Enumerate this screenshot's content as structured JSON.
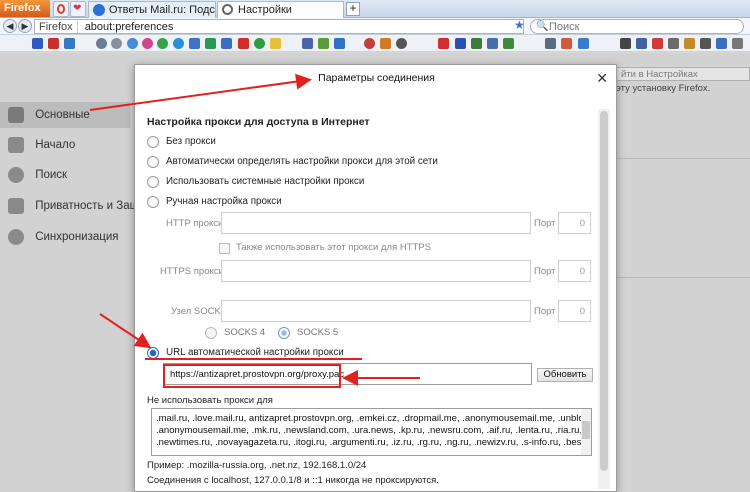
{
  "browser": {
    "app_button": "Firefox",
    "tabs": [
      {
        "label": "Ответы Mail.ru: Подсказ",
        "active": false
      },
      {
        "label": "Настройки",
        "active": true
      }
    ],
    "new_tab": "+",
    "url_identity": "Firefox",
    "url": "about:preferences",
    "search_placeholder": "Поиск"
  },
  "prefs_page": {
    "sidebar": [
      {
        "label": "Основные",
        "icon": "general-icon",
        "active": true
      },
      {
        "label": "Начало",
        "icon": "home-icon",
        "active": false
      },
      {
        "label": "Поиск",
        "icon": "search-icon",
        "active": false
      },
      {
        "label": "Приватность и Защит",
        "icon": "privacy-mask-icon",
        "active": false
      },
      {
        "label": "Синхронизация",
        "icon": "sync-icon",
        "active": false
      }
    ],
    "search_placeholder": "йти в Настройках",
    "right_text": "эту установку Firefox."
  },
  "dialog": {
    "title": "Параметры соединения",
    "close": "✕",
    "section_title": "Настройка прокси для доступа в Интернет",
    "options": {
      "no_proxy": "Без прокси",
      "auto_detect": "Автоматически определять настройки прокси для этой сети",
      "system": "Использовать системные настройки прокси",
      "manual": "Ручная настройка прокси",
      "auto_url": "URL автоматической настройки прокси"
    },
    "http_proxy_label": "HTTP прокси",
    "https_proxy_label": "HTTPS прокси",
    "socks_label": "Узел SOCKS",
    "port_label": "Порт",
    "port_value": "0",
    "also_https_label": "Также использовать этот прокси для HTTPS",
    "socks4": "SOCKS 4",
    "socks5": "SOCKS 5",
    "pac_url": "https://antizapret.prostovpn.org/proxy.pac",
    "reload_button": "Обновить",
    "no_proxy_label": "Не использовать прокси для",
    "no_proxy_lines": [
      ".mail.ru, .love.mail.ru, antizapret.prostovpn.org, .emkei.cz, .dropmail.me, .anonymousemail.me, .unblocksit.es,",
      ".anonymousemail.me, .mk.ru, .newsland.com, .ura.news, .kp.ru, .newsru.com, .aif.ru, .lenta.ru, .ria.ru, .gazeta.ru,",
      ".newtimes.ru, .novayagazeta.ru, .itogi.ru, .argumenti.ru, .iz.ru, .rg.ru, .ng.ru, .newizv.ru, .s-info.ru, .bestmaps.ru,"
    ],
    "example": "Пример: .mozilla-russia.org, .net.nz, 192.168.1.0/24",
    "localhost": "Соединения с localhost, 127.0.0.1/8 и ::1 никогда не проксируются."
  },
  "colors": {
    "annotation": "#e32020",
    "accent": "#2a66c8"
  }
}
